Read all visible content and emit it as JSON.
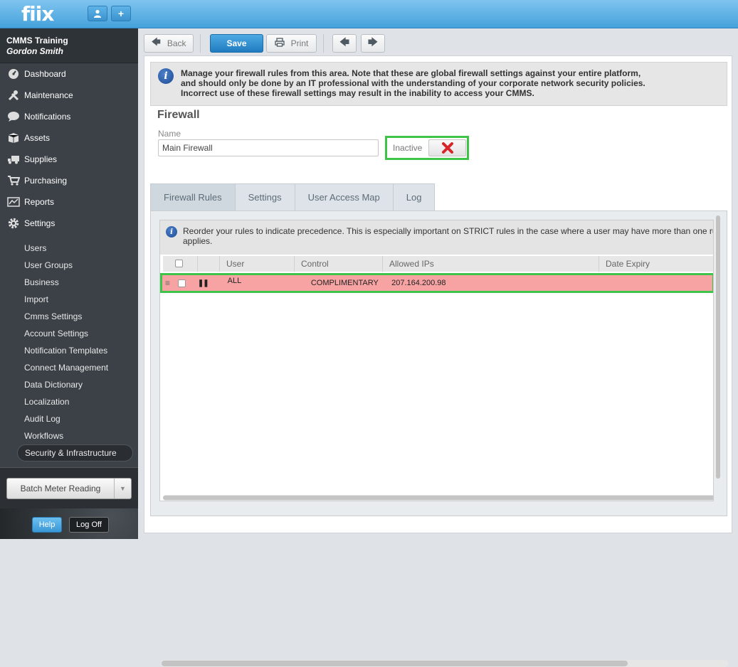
{
  "app": {
    "logo": "fiix"
  },
  "header": {
    "user_icon": "user-icon",
    "add_icon": "plus-icon",
    "add_label": "+"
  },
  "sidebar": {
    "org": "CMMS Training",
    "user": "Gordon Smith",
    "nav": [
      {
        "label": "Dashboard",
        "icon": "dashboard-icon"
      },
      {
        "label": "Maintenance",
        "icon": "tools-icon"
      },
      {
        "label": "Notifications",
        "icon": "speech-bubble-icon"
      },
      {
        "label": "Assets",
        "icon": "box-icon"
      },
      {
        "label": "Supplies",
        "icon": "truck-icon"
      },
      {
        "label": "Purchasing",
        "icon": "cart-icon"
      },
      {
        "label": "Reports",
        "icon": "chart-icon"
      },
      {
        "label": "Settings",
        "icon": "gear-icon"
      }
    ],
    "sub": [
      "Users",
      "User Groups",
      "Business",
      "Import",
      "Cmms Settings",
      "Account Settings",
      "Notification Templates",
      "Connect Management",
      "Data Dictionary",
      "Localization",
      "Audit Log",
      "Workflows",
      "Security & Infrastructure"
    ],
    "active_sub": "Security & Infrastructure",
    "batch_label": "Batch Meter Reading",
    "help_label": "Help",
    "logoff_label": "Log Off"
  },
  "toolbar": {
    "back": "Back",
    "save": "Save",
    "print": "Print"
  },
  "notice": "Manage your firewall rules from this area. Note that these are global firewall settings against your entire platform, and should only be done by an IT professional with the understanding of your corporate network security policies. Incorrect use of these firewall settings may result in the inability to access your CMMS.",
  "form": {
    "title": "Firewall",
    "name_label": "Name",
    "name_value": "Main Firewall",
    "status": "Inactive",
    "status_icon": "x-icon"
  },
  "tabs": [
    "Firewall Rules",
    "Settings",
    "User Access Map",
    "Log"
  ],
  "active_tab": "Firewall Rules",
  "rules": {
    "notice_line1": "Reorder your rules to indicate precedence. This is especially important on STRICT rules in the case where a user may have more than one ru",
    "notice_line2": "applies.",
    "columns": [
      "User",
      "Control",
      "Allowed IPs",
      "Date Expiry"
    ],
    "rows": [
      {
        "user": "ALL",
        "control": "COMPLIMENTARY",
        "allowed_ips": "207.164.200.98",
        "date_expiry": ""
      }
    ],
    "row_color": "#f7a3a3",
    "highlight_color": "#3ec44a"
  }
}
